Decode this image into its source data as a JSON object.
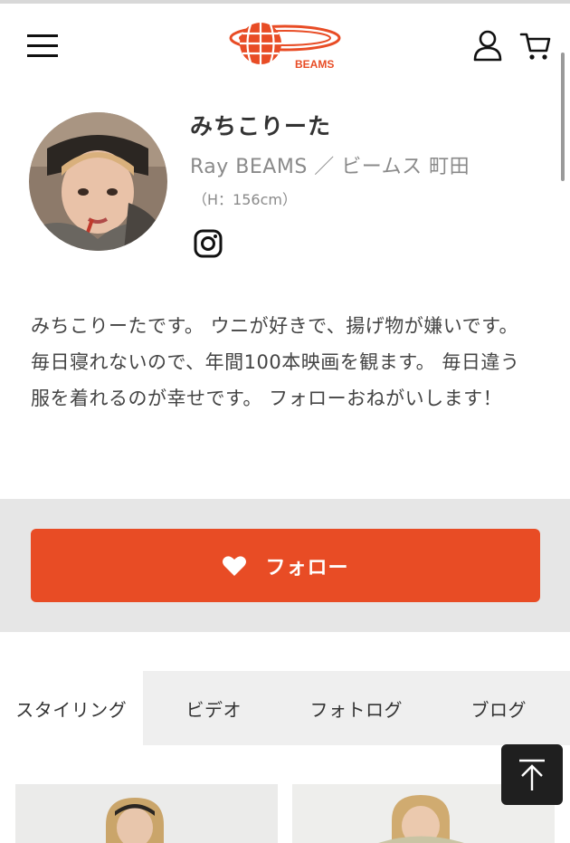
{
  "header": {
    "logo_text": "BEAMS",
    "menu_icon": "hamburger-icon",
    "account_icon": "user-icon",
    "cart_icon": "cart-icon"
  },
  "profile": {
    "name": "みちこりーた",
    "shop": "Ray BEAMS ／ ビームス 町田",
    "height": "（H：156cm）",
    "instagram_icon": "instagram-icon",
    "bio": "みちこりーたです。 ウニが好きで、揚げ物が嫌いです。 毎日寝れないので、年間100本映画を観ます。 毎日違う服を着れるのが幸せです。 フォローおねがいします！"
  },
  "follow": {
    "label": "フォロー",
    "icon": "heart-icon"
  },
  "tabs": [
    {
      "label": "スタイリング"
    },
    {
      "label": "ビデオ"
    },
    {
      "label": "フォトログ"
    },
    {
      "label": "ブログ"
    }
  ],
  "colors": {
    "brand": "#e84c25",
    "tab_bg": "#efefef",
    "band_bg": "#e6e6e6"
  },
  "to_top_icon": "arrow-up-icon"
}
